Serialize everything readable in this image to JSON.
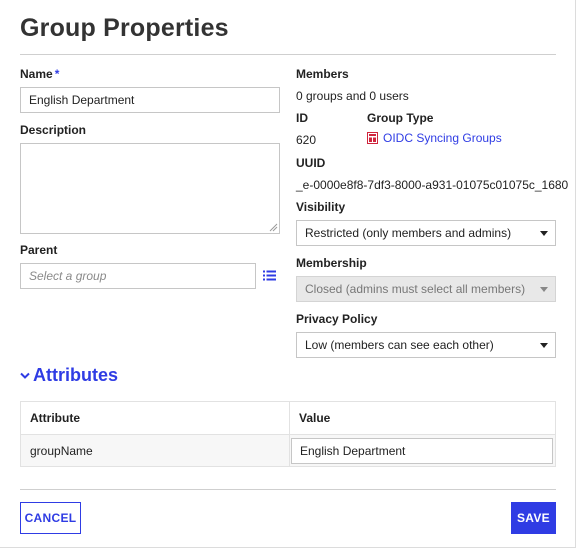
{
  "dialog": {
    "title": "Group Properties"
  },
  "form": {
    "name_label": "Name",
    "name_required_mark": "*",
    "name_value": "English Department",
    "description_label": "Description",
    "description_value": "",
    "parent_label": "Parent",
    "parent_placeholder": "Select a group"
  },
  "info": {
    "members_label": "Members",
    "members_value": "0 groups and 0 users",
    "id_label": "ID",
    "id_value": "620",
    "group_type_label": "Group Type",
    "group_type_value": "OIDC Syncing Groups",
    "uuid_label": "UUID",
    "uuid_value": "_e-0000e8f8-7df3-8000-a931-01075c01075c_1680",
    "visibility_label": "Visibility",
    "visibility_value": "Restricted (only members and admins)",
    "membership_label": "Membership",
    "membership_value": "Closed (admins must select all members)",
    "privacy_label": "Privacy Policy",
    "privacy_value": "Low (members can see each other)"
  },
  "attributes": {
    "title": "Attributes",
    "columns": [
      "Attribute",
      "Value"
    ],
    "rows": [
      {
        "attribute": "groupName",
        "value": "English Department"
      }
    ]
  },
  "footer": {
    "cancel_label": "CANCEL",
    "save_label": "SAVE"
  },
  "colors": {
    "accent": "#2f3ce4",
    "group_type_icon": "#d0243c"
  }
}
